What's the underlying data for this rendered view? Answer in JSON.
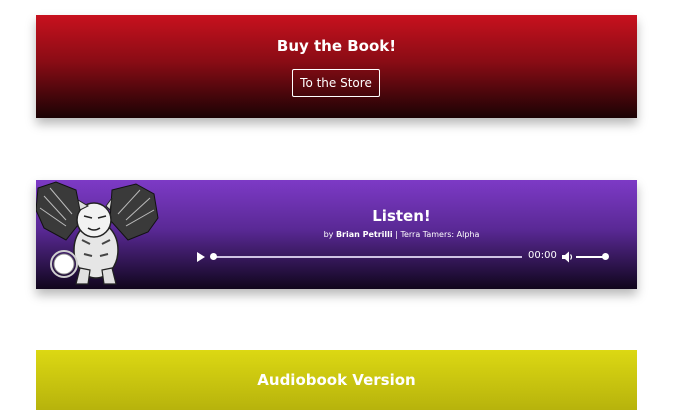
{
  "buy": {
    "title": "Buy the Book!",
    "button_label": "To the Store",
    "colors": {
      "top": "#c8111e",
      "bottom": "#1a0204"
    }
  },
  "listen": {
    "title": "Listen!",
    "by": "by ",
    "author": "Brian Petrilli",
    "separator": " | ",
    "album": "Terra Tamers: Alpha",
    "artwork_icon": "winged-tiger-illustration",
    "player": {
      "time": "00:00",
      "progress": 0,
      "volume": 1.0,
      "play_icon": "play-icon",
      "volume_icon": "speaker-icon"
    },
    "colors": {
      "top": "#7d3ac6",
      "bottom": "#10061c"
    }
  },
  "audiobook": {
    "title": "Audiobook Version",
    "colors": {
      "top": "#dcd813",
      "bottom": "#b7b30c"
    }
  }
}
